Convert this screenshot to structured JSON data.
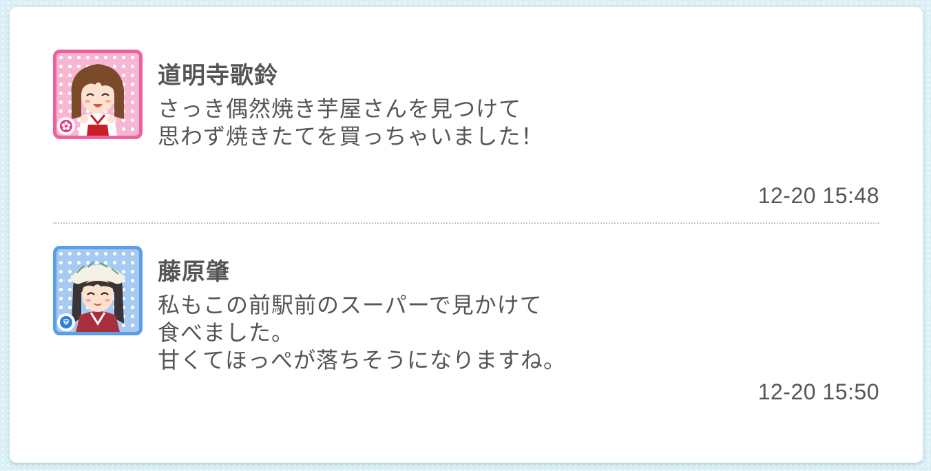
{
  "messages": [
    {
      "name": "道明寺歌鈴",
      "lines": [
        "さっき偶然焼き芋屋さんを見つけて",
        "思わず焼きたてを買っちゃいました！"
      ],
      "time": "12-20 15:48",
      "avatar_icon": "character-avatar-pink",
      "badge_icon": "flower-icon",
      "frame_color": "#f0609e"
    },
    {
      "name": "藤原肇",
      "lines": [
        "私もこの前駅前のスーパーで見かけて",
        "食べました。",
        "甘くてほっぺが落ちそうになりますね。"
      ],
      "time": "12-20 15:50",
      "avatar_icon": "character-avatar-blue",
      "badge_icon": "diamond-icon",
      "frame_color": "#5b9ee6"
    }
  ]
}
